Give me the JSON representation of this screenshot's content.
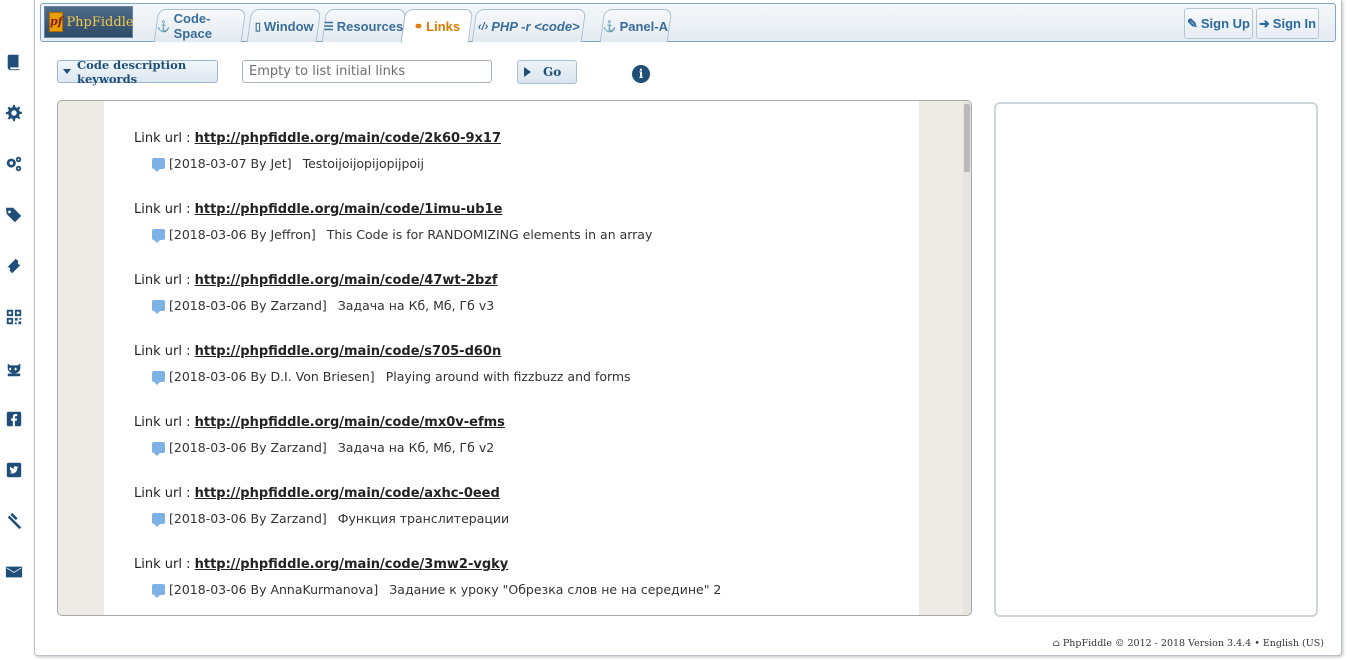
{
  "header": {
    "logo_mark": "pf",
    "logo_text": "PhpFiddle",
    "tabs": [
      {
        "label": "Code-Space",
        "icon": "code-space-icon",
        "glyph": "⚓"
      },
      {
        "label": "Window",
        "icon": "window-icon",
        "glyph": "□"
      },
      {
        "label": "Resources",
        "icon": "resources-icon",
        "glyph": "☷"
      },
      {
        "label": "Links",
        "icon": "link-icon",
        "glyph": "⊕",
        "active": true
      },
      {
        "label": "PHP -r <code>",
        "icon": "code-icon",
        "glyph": "</>"
      },
      {
        "label": "Panel-A",
        "icon": "anchor-icon",
        "glyph": "⚓"
      }
    ],
    "sign_up": "Sign Up",
    "sign_in": "Sign In"
  },
  "toolbar": {
    "keywords_label": "Code description keywords",
    "search_placeholder": "Empty to list initial links",
    "go_label": "Go"
  },
  "sidebar_icons": [
    "book-icon",
    "gear-icon",
    "gears-icon",
    "tags-icon",
    "ticket-icon",
    "qrcode-icon",
    "github-icon",
    "facebook-icon",
    "twitter-icon",
    "gavel-icon",
    "envelope-icon"
  ],
  "links": {
    "prefix": "Link url :",
    "items": [
      {
        "url": "http://phpfiddle.org/main/code/2k60-9x17",
        "meta": "[2018-03-07 By Jet]",
        "desc": "Testoijoijopijopijpoij"
      },
      {
        "url": "http://phpfiddle.org/main/code/1imu-ub1e",
        "meta": "[2018-03-06 By Jeffron]",
        "desc": "This Code is for RANDOMIZING elements in an array"
      },
      {
        "url": "http://phpfiddle.org/main/code/47wt-2bzf",
        "meta": "[2018-03-06 By Zarzand]",
        "desc": "Задача на Кб, Мб, Гб v3"
      },
      {
        "url": "http://phpfiddle.org/main/code/s705-d60n",
        "meta": "[2018-03-06 By D.I. Von Briesen]",
        "desc": "Playing around with fizzbuzz and forms"
      },
      {
        "url": "http://phpfiddle.org/main/code/mx0v-efms",
        "meta": "[2018-03-06 By Zarzand]",
        "desc": "Задача на Кб, Мб, Гб v2"
      },
      {
        "url": "http://phpfiddle.org/main/code/axhc-0eed",
        "meta": "[2018-03-06 By Zarzand]",
        "desc": "Функция транслитерации"
      },
      {
        "url": "http://phpfiddle.org/main/code/3mw2-vgky",
        "meta": "[2018-03-06 By AnnaKurmanova]",
        "desc": "Задание к уроку \"Обрезка слов не на середине\" 2"
      }
    ]
  },
  "footer": {
    "text": "PhpFiddle © 2012 - 2018 Version 3.4.4 • English (US)"
  }
}
